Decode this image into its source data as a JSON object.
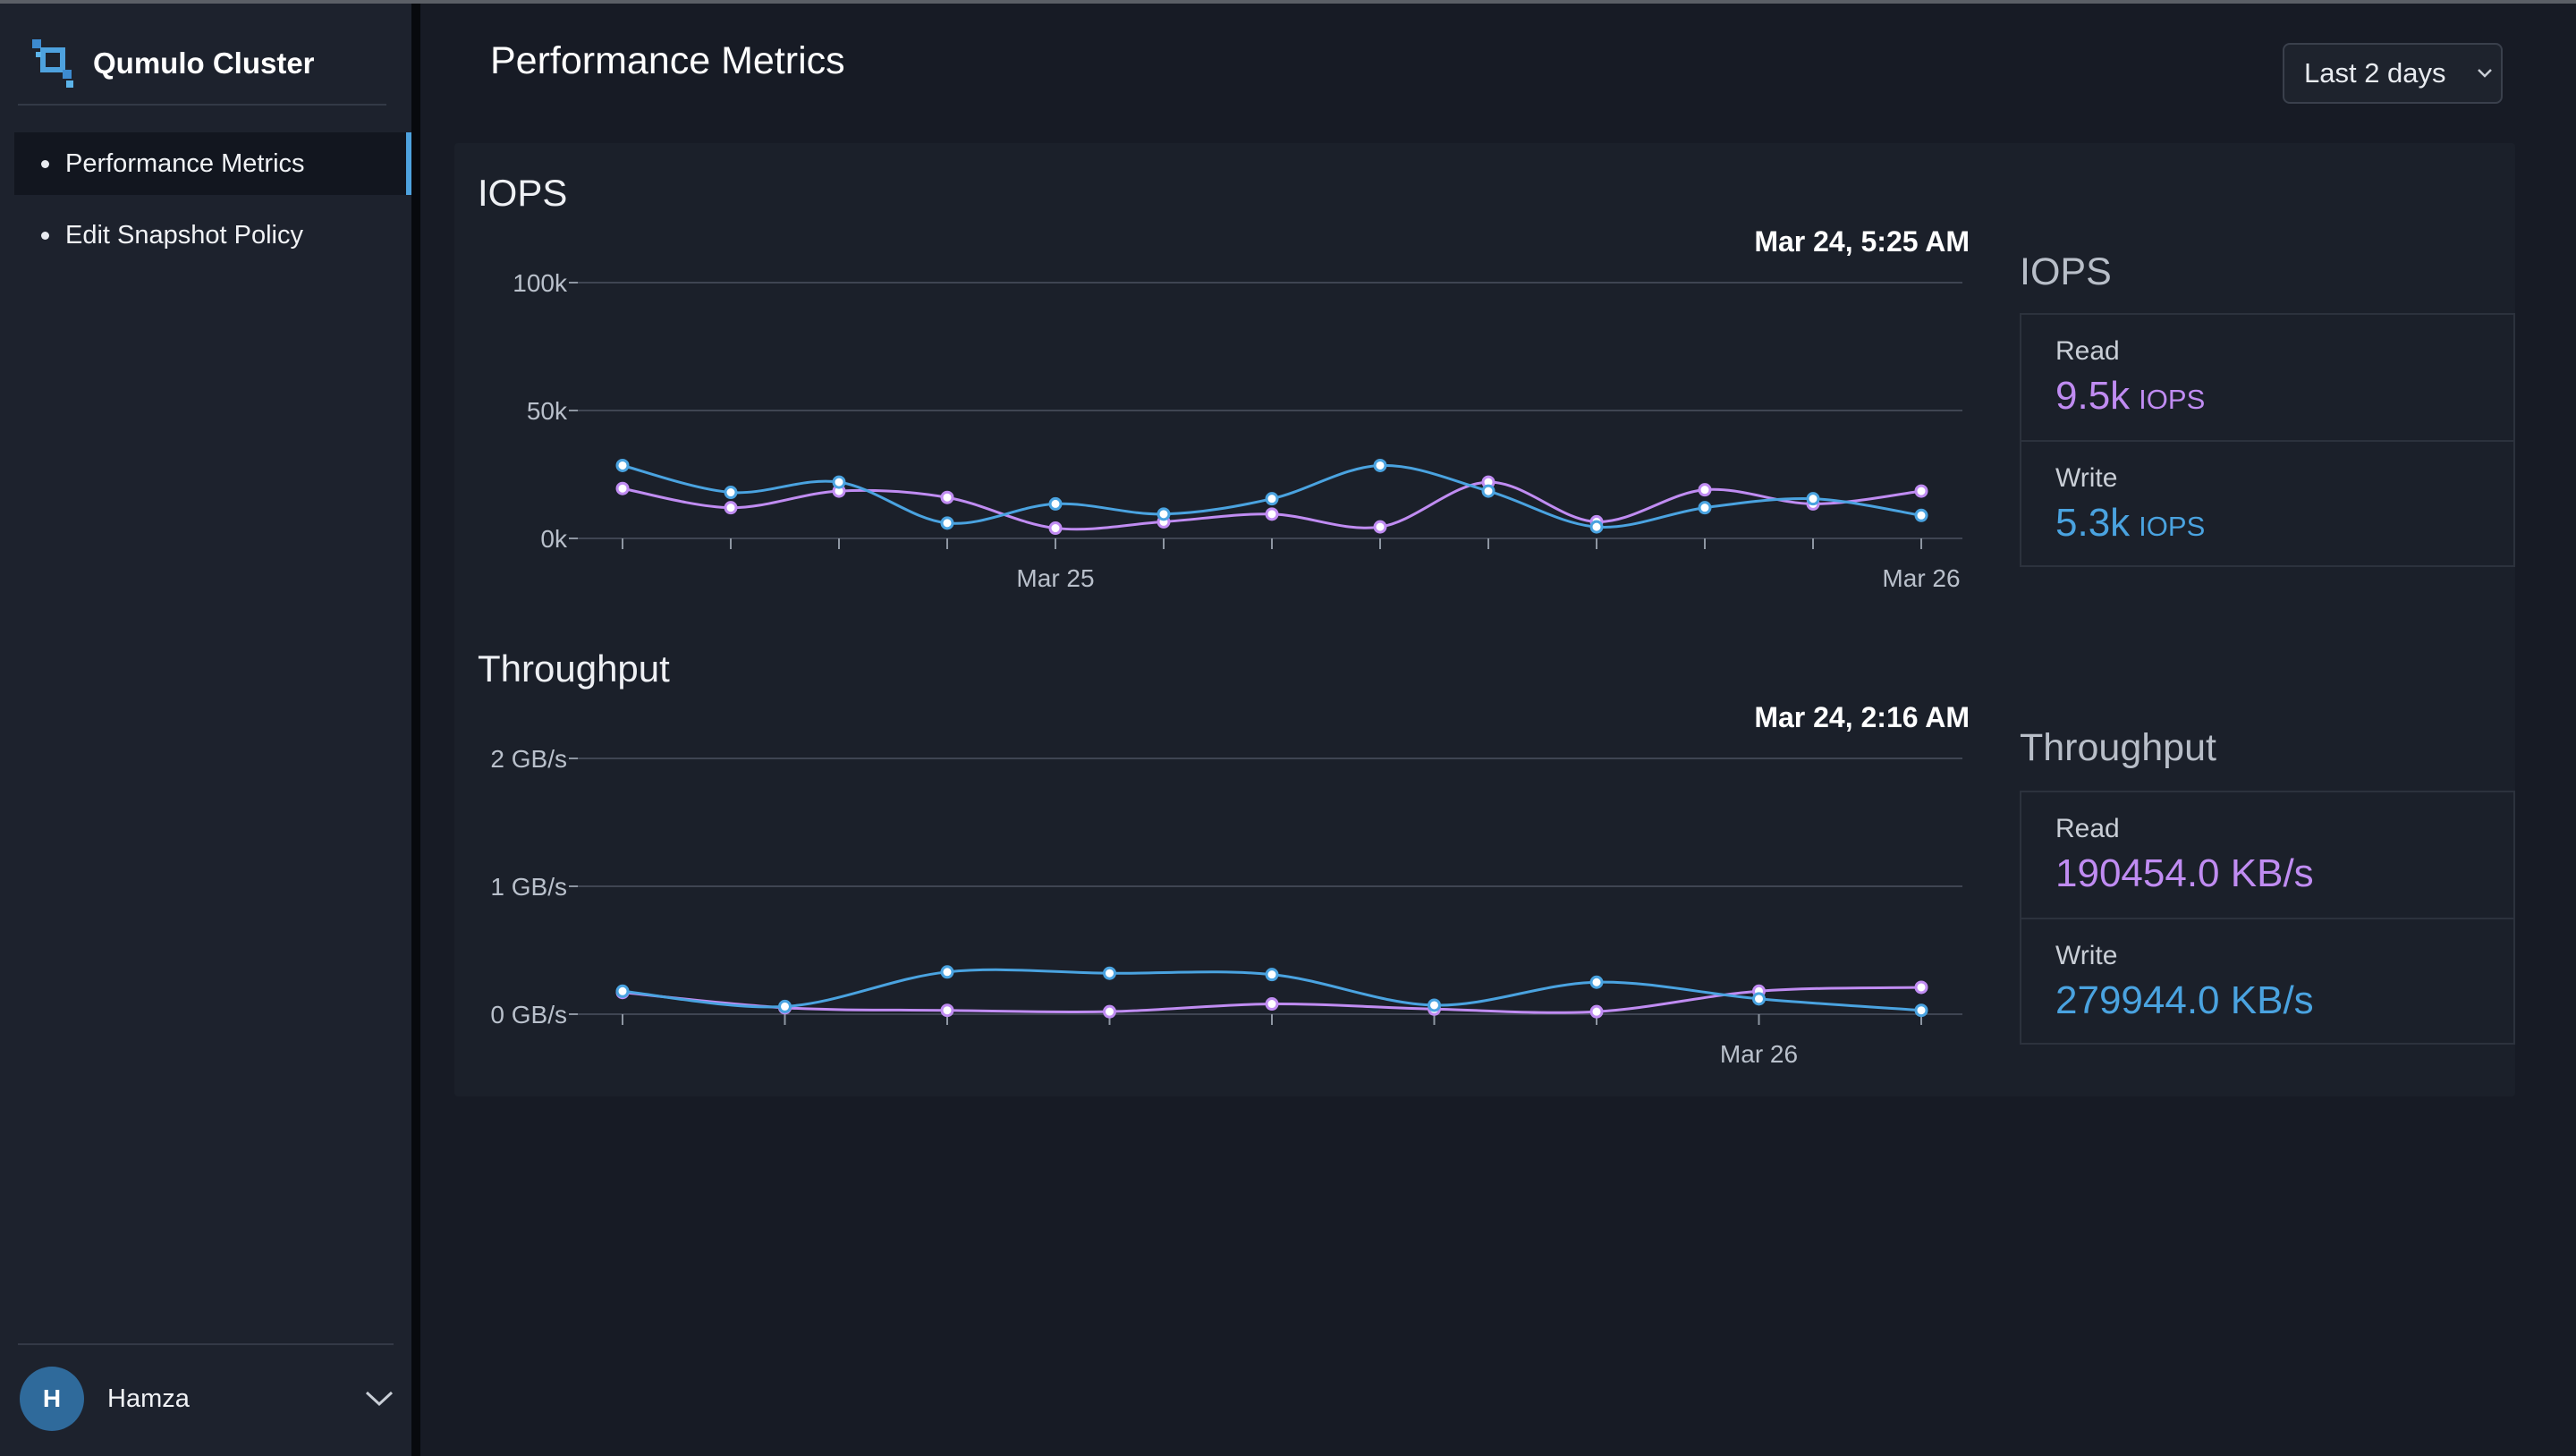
{
  "app": {
    "title": "Qumulo Cluster"
  },
  "sidebar": {
    "items": [
      {
        "label": "Performance Metrics",
        "active": true
      },
      {
        "label": "Edit Snapshot Policy",
        "active": false
      }
    ],
    "user": {
      "initial": "H",
      "name": "Hamza"
    }
  },
  "header": {
    "title": "Performance Metrics",
    "range_selected": "Last 2 days"
  },
  "colors": {
    "read": "#c08cf2",
    "write": "#4aa3e0",
    "accent": "#4ea2de"
  },
  "iops": {
    "section_title": "IOPS",
    "timestamp": "Mar 24, 5:25 AM",
    "stats_title": "IOPS",
    "read_label": "Read",
    "read_value": "9.5k",
    "read_unit": "IOPS",
    "write_label": "Write",
    "write_value": "5.3k",
    "write_unit": "IOPS"
  },
  "throughput": {
    "section_title": "Throughput",
    "timestamp": "Mar 24, 2:16 AM",
    "stats_title": "Throughput",
    "read_label": "Read",
    "read_value": "190454.0 KB/s",
    "write_label": "Write",
    "write_value": "279944.0 KB/s"
  },
  "chart_data": [
    {
      "type": "line",
      "name": "IOPS",
      "ylim": [
        0,
        100000
      ],
      "y_ticks": [
        0,
        50000,
        100000
      ],
      "y_tick_labels": [
        "0k",
        "50k",
        "100k"
      ],
      "x": [
        0,
        1,
        2,
        3,
        4,
        5,
        6,
        7,
        8,
        9,
        10,
        11,
        12
      ],
      "x_tick_labels": [
        {
          "at": 4,
          "label": "Mar 25"
        },
        {
          "at": 12,
          "label": "Mar 26"
        }
      ],
      "grid": true,
      "series": [
        {
          "color": "#c08cf2",
          "values": [
            19500,
            12000,
            18500,
            16000,
            4000,
            6500,
            9500,
            4500,
            22000,
            6500,
            19000,
            13500,
            18500
          ]
        },
        {
          "color": "#4aa3e0",
          "values": [
            28500,
            18000,
            22000,
            6000,
            13500,
            9500,
            15500,
            28500,
            18500,
            4500,
            12000,
            15500,
            9000
          ]
        }
      ]
    },
    {
      "type": "line",
      "name": "Throughput",
      "ylim": [
        0,
        2
      ],
      "y_ticks": [
        0,
        1,
        2
      ],
      "y_tick_labels": [
        "0 GB/s",
        "1 GB/s",
        "2 GB/s"
      ],
      "x": [
        0,
        1,
        2,
        3,
        4,
        5,
        6,
        7,
        8
      ],
      "x_tick_labels": [
        {
          "at": 7,
          "label": "Mar 26"
        }
      ],
      "grid": true,
      "series": [
        {
          "color": "#c08cf2",
          "values": [
            0.17,
            0.05,
            0.03,
            0.02,
            0.08,
            0.04,
            0.02,
            0.18,
            0.21
          ]
        },
        {
          "color": "#4aa3e0",
          "values": [
            0.18,
            0.06,
            0.33,
            0.32,
            0.31,
            0.07,
            0.25,
            0.12,
            0.03
          ]
        }
      ]
    }
  ]
}
